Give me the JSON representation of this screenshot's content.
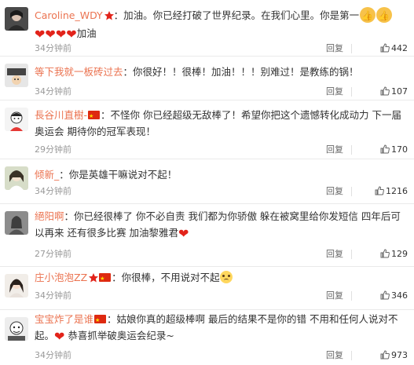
{
  "comments": [
    {
      "username": "Caroline_WDY",
      "text1": "：加油。你已经打破了世界纪录。在我们心里。你是第一",
      "text2": "加油",
      "time": "34分钟前",
      "reply": "回复",
      "likes": "442"
    },
    {
      "username": "等下我就一板砖过去",
      "text1": "：你很好！！很棒！加油！！！别难过！是教练的锅！",
      "time": "34分钟前",
      "reply": "回复",
      "likes": "107"
    },
    {
      "username": "長谷川直樹-",
      "text1": "：不怪你 你已经超级无敌棒了！希望你把这个遗憾转化成动力 下一届奥运会 期待你的冠军表现！",
      "time": "29分钟前",
      "reply": "回复",
      "likes": "170"
    },
    {
      "username": "倾新_",
      "text1": "：你是英雄干嘛说对不起！",
      "time": "34分钟前",
      "reply": "回复",
      "likes": "1216"
    },
    {
      "username": "絕阳啊",
      "text1": "：你已经很棒了 你不必自责 我们都为你骄傲 躲在被窝里给你发短信 四年后可以再来 还有很多比赛 加油黎雅君",
      "time": "27分钟前",
      "reply": "回复",
      "likes": "129"
    },
    {
      "username": "庄小泡泡ZZ",
      "text1": "：你很棒，不用说对不起",
      "time": "34分钟前",
      "reply": "回复",
      "likes": "346"
    },
    {
      "username": "宝宝炸了是谁",
      "text1": "：姑娘你真的超级棒啊 最后的结果不是你的错 不用和任何人说对不起。",
      "text2": "恭喜抓举破奥运会纪录~",
      "time": "34分钟前",
      "reply": "回复",
      "likes": "973"
    }
  ],
  "colors": {
    "username": "#eb7350",
    "meta": "#999999",
    "divider": "#eaeaea",
    "heart": "#e2231a",
    "flag": "#de2910"
  },
  "icons": {
    "like": "thumbs-up-icon",
    "flag": "china-flag-icon",
    "heart": "red-heart-icon",
    "vip": "star-badge-icon",
    "emoji_sad": "crying-face-icon"
  }
}
